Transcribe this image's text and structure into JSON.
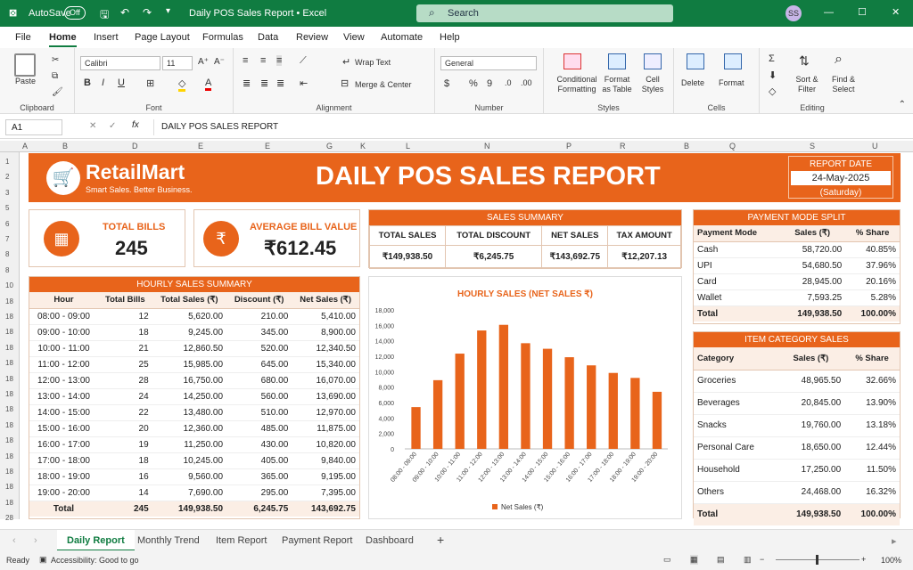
{
  "window": {
    "autosave_label": "AutoSave",
    "autosave_state": "Off",
    "title": "Daily POS Sales Report • Excel",
    "search_placeholder": "Search",
    "user_initials": "SS"
  },
  "tabs": [
    "File",
    "Home",
    "Insert",
    "Page Layout",
    "Formulas",
    "Data",
    "Review",
    "View",
    "Automate",
    "Help"
  ],
  "ribbon": {
    "clipboard": {
      "paste": "Paste",
      "label": "Clipboard"
    },
    "font": {
      "name": "Calibri",
      "size": "11",
      "label": "Font"
    },
    "alignment": {
      "wrap": "Wrap Text",
      "merge": "Merge & Center",
      "label": "Alignment"
    },
    "number": {
      "format": "General",
      "label": "Number"
    },
    "styles": {
      "conditional": "Conditional Formatting",
      "format_table": "Format as Table",
      "cell_styles": "Cell Styles",
      "label": "Styles"
    },
    "cells": {
      "delete": "Delete",
      "format": "Format",
      "label": "Cells"
    },
    "editing": {
      "sort": "Sort & Filter",
      "find": "Find & Select",
      "label": "Editing"
    }
  },
  "formula_bar": {
    "cell_ref": "A1",
    "fx": "fx",
    "content": "DAILY POS SALES REPORT"
  },
  "columns": [
    "A",
    "B",
    "D",
    "E",
    "E",
    "G",
    "K",
    "L",
    "N",
    "P",
    "R",
    "B",
    "Q",
    "S",
    "U"
  ],
  "rows": [
    "1",
    "2",
    "3",
    "5",
    "6",
    "7",
    "8",
    "8",
    "10",
    "18",
    "18",
    "18",
    "18",
    "18",
    "18",
    "18",
    "18",
    "18",
    "18",
    "18",
    "18",
    "18",
    "18",
    "28"
  ],
  "report": {
    "brand": "RetailMart",
    "tagline": "Smart Sales. Better Business.",
    "title": "DAILY POS SALES REPORT",
    "date_label": "REPORT DATE",
    "date": "24-May-2025",
    "day": "(Saturday)",
    "kpi_bills_label": "TOTAL BILLS",
    "kpi_bills": "245",
    "kpi_avg_label": "AVERAGE BILL VALUE",
    "kpi_avg": "₹612.45"
  },
  "summary": {
    "title": "SALES SUMMARY",
    "headers": [
      "TOTAL SALES",
      "TOTAL DISCOUNT",
      "NET SALES",
      "TAX AMOUNT"
    ],
    "values": [
      "₹149,938.50",
      "₹6,245.75",
      "₹143,692.75",
      "₹12,207.13"
    ]
  },
  "payment": {
    "title": "PAYMENT MODE SPLIT",
    "headers": [
      "Payment Mode",
      "Sales (₹)",
      "% Share"
    ],
    "rows": [
      [
        "Cash",
        "58,720.00",
        "40.85%"
      ],
      [
        "UPI",
        "54,680.50",
        "37.96%"
      ],
      [
        "Card",
        "28,945.00",
        "20.16%"
      ],
      [
        "Wallet",
        "7,593.25",
        "5.28%"
      ]
    ],
    "total": [
      "Total",
      "149,938.50",
      "100.00%"
    ]
  },
  "category": {
    "title": "ITEM CATEGORY SALES",
    "headers": [
      "Category",
      "Sales (₹)",
      "% Share"
    ],
    "rows": [
      [
        "Groceries",
        "48,965.50",
        "32.66%"
      ],
      [
        "Beverages",
        "20,845.00",
        "13.90%"
      ],
      [
        "Snacks",
        "19,760.00",
        "13.18%"
      ],
      [
        "Personal Care",
        "18,650.00",
        "12.44%"
      ],
      [
        "Household",
        "17,250.00",
        "11.50%"
      ],
      [
        "Others",
        "24,468.00",
        "16.32%"
      ]
    ],
    "total": [
      "Total",
      "149,938.50",
      "100.00%"
    ]
  },
  "hourly": {
    "title": "HOURLY SALES SUMMARY",
    "headers": [
      "Hour",
      "Total Bills",
      "Total Sales (₹)",
      "Discount (₹)",
      "Net Sales (₹)"
    ],
    "rows": [
      [
        "08:00 - 09:00",
        "12",
        "5,620.00",
        "210.00",
        "5,410.00"
      ],
      [
        "09:00 - 10:00",
        "18",
        "9,245.00",
        "345.00",
        "8,900.00"
      ],
      [
        "10:00 - 11:00",
        "21",
        "12,860.50",
        "520.00",
        "12,340.50"
      ],
      [
        "11:00 - 12:00",
        "25",
        "15,985.00",
        "645.00",
        "15,340.00"
      ],
      [
        "12:00 - 13:00",
        "28",
        "16,750.00",
        "680.00",
        "16,070.00"
      ],
      [
        "13:00 - 14:00",
        "24",
        "14,250.00",
        "560.00",
        "13,690.00"
      ],
      [
        "14:00 - 15:00",
        "22",
        "13,480.00",
        "510.00",
        "12,970.00"
      ],
      [
        "15:00 - 16:00",
        "20",
        "12,360.00",
        "485.00",
        "11,875.00"
      ],
      [
        "16:00 - 17:00",
        "19",
        "11,250.00",
        "430.00",
        "10,820.00"
      ],
      [
        "17:00 - 18:00",
        "18",
        "10,245.00",
        "405.00",
        "9,840.00"
      ],
      [
        "18:00 - 19:00",
        "16",
        "9,560.00",
        "365.00",
        "9,195.00"
      ],
      [
        "19:00 - 20:00",
        "14",
        "7,690.00",
        "295.00",
        "7,395.00"
      ]
    ],
    "total": [
      "Total",
      "245",
      "149,938.50",
      "6,245.75",
      "143,692.75"
    ]
  },
  "chart_data": {
    "type": "bar",
    "title": "HOURLY SALES (NET SALES ₹)",
    "categories": [
      "08:00 - 09:00",
      "09:00 - 10:00",
      "10:00 - 11:00",
      "11:00 - 12:00",
      "12:00 - 13:00",
      "13:00 - 14:00",
      "14:00 - 15:00",
      "15:00 - 16:00",
      "16:00 - 17:00",
      "17:00 - 18:00",
      "18:00 - 19:00",
      "19:00 - 20:00"
    ],
    "series": [
      {
        "name": "Net Sales (₹)",
        "values": [
          5410,
          8900,
          12340.5,
          15340,
          16070,
          13690,
          12970,
          11875,
          10820,
          9840,
          9195,
          7395
        ]
      }
    ],
    "ylim": [
      0,
      18000
    ],
    "yticks": [
      "0",
      "2,000",
      "4,000",
      "6,000",
      "8,000",
      "10,000",
      "12,000",
      "14,000",
      "16,000",
      "18,000"
    ],
    "legend": "bottom",
    "color": "#e8641b"
  },
  "sheet_tabs": [
    "Daily Report",
    "Monthly Trend",
    "Item Report",
    "Payment Report",
    "Dashboard"
  ],
  "status": {
    "ready": "Ready",
    "accessibility": "Accessibility: Good to go",
    "zoom": "100%"
  }
}
